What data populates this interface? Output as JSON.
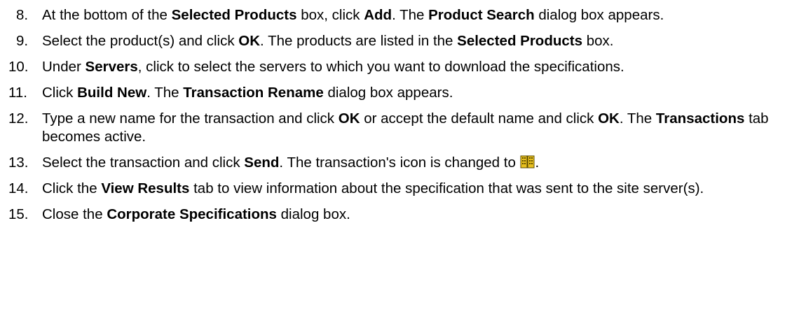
{
  "steps": [
    {
      "num": "8.",
      "parts": [
        {
          "t": "At the bottom of the "
        },
        {
          "b": "Selected Products"
        },
        {
          "t": " box, click "
        },
        {
          "b": "Add"
        },
        {
          "t": ". The "
        },
        {
          "b": "Product Search"
        },
        {
          "t": " dialog box appears."
        }
      ]
    },
    {
      "num": "9.",
      "parts": [
        {
          "t": "Select the product(s) and click "
        },
        {
          "b": "OK"
        },
        {
          "t": ". The products are listed in the "
        },
        {
          "b": "Selected Products"
        },
        {
          "t": " box."
        }
      ]
    },
    {
      "num": "10.",
      "parts": [
        {
          "t": "Under "
        },
        {
          "b": "Servers"
        },
        {
          "t": ", click to select the servers to which you want to download the specifications."
        }
      ]
    },
    {
      "num": "11.",
      "parts": [
        {
          "t": "Click "
        },
        {
          "b": "Build New"
        },
        {
          "t": ". The "
        },
        {
          "b": "Transaction Rename"
        },
        {
          "t": " dialog box appears."
        }
      ]
    },
    {
      "num": "12.",
      "parts": [
        {
          "t": "Type a new name for the transaction and click "
        },
        {
          "b": "OK"
        },
        {
          "t": " or accept the default name and click "
        },
        {
          "b": "OK"
        },
        {
          "t": ". The "
        },
        {
          "b": "Transactions"
        },
        {
          "t": " tab becomes active."
        }
      ]
    },
    {
      "num": "13.",
      "parts": [
        {
          "t": "Select the transaction and click "
        },
        {
          "b": "Send"
        },
        {
          "t": ". The transaction's icon is changed to "
        },
        {
          "icon": "transaction-sent-icon"
        },
        {
          "t": "."
        }
      ]
    },
    {
      "num": "14.",
      "parts": [
        {
          "t": "Click the "
        },
        {
          "b": "View Results"
        },
        {
          "t": " tab to view information about the specification that was sent to the site server(s)."
        }
      ]
    },
    {
      "num": "15.",
      "parts": [
        {
          "t": "Close the "
        },
        {
          "b": "Corporate Specifications"
        },
        {
          "t": " dialog box."
        }
      ]
    }
  ],
  "colors": {
    "text": "#000000",
    "icon_body": "#e8c020",
    "icon_outline": "#5a4a00"
  }
}
